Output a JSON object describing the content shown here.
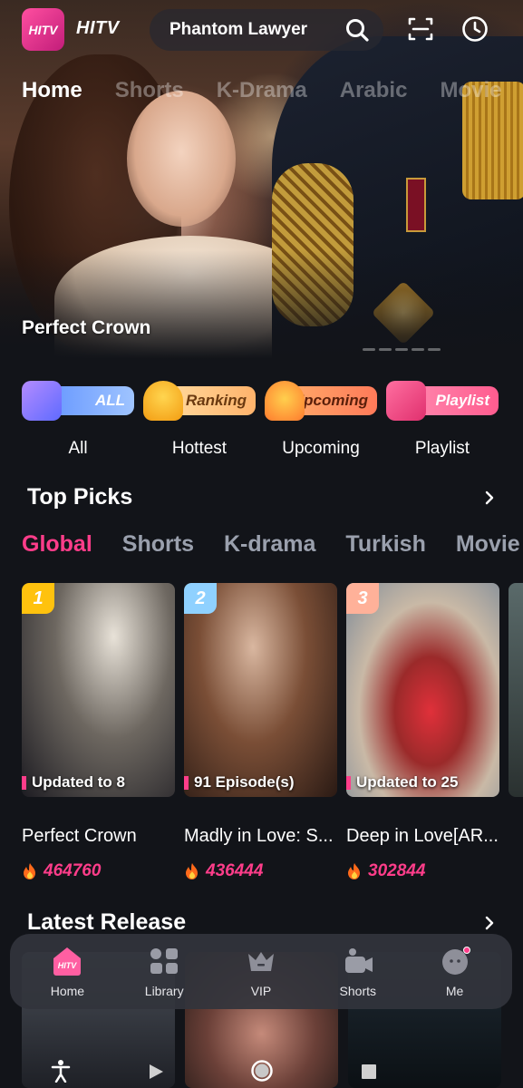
{
  "app": {
    "logo_text": "HITV",
    "logo_badge": "HITV"
  },
  "search": {
    "query": "Phantom Lawyer"
  },
  "top_tabs": [
    {
      "label": "Home",
      "active": true
    },
    {
      "label": "Shorts",
      "active": false
    },
    {
      "label": "K-Drama",
      "active": false
    },
    {
      "label": "Arabic",
      "active": false
    },
    {
      "label": "Movie",
      "active": false
    }
  ],
  "hero": {
    "title": "Perfect Crown"
  },
  "categories": [
    {
      "pill": "ALL",
      "label": "All",
      "color": "#6ba4ff"
    },
    {
      "pill": "Ranking",
      "label": "Hottest",
      "color": "#ffcc80"
    },
    {
      "pill": "Upcoming",
      "label": "Upcoming",
      "color": "#ff9d5c"
    },
    {
      "pill": "Playlist",
      "label": "Playlist",
      "color": "#ff7aa8"
    }
  ],
  "top_picks": {
    "title": "Top Picks",
    "subtabs": [
      {
        "label": "Global",
        "active": true
      },
      {
        "label": "Shorts",
        "active": false
      },
      {
        "label": "K-drama",
        "active": false
      },
      {
        "label": "Turkish",
        "active": false
      },
      {
        "label": "Movie",
        "active": false
      }
    ],
    "cards": [
      {
        "rank": "1",
        "status": "Updated to 8",
        "title": "Perfect Crown",
        "views": "464760",
        "rank_color": "#ffc20e"
      },
      {
        "rank": "2",
        "status": "91 Episode(s)",
        "title": "Madly in Love: S...",
        "views": "436444",
        "rank_color": "#8fd1ff"
      },
      {
        "rank": "3",
        "status": "Updated to 25",
        "title": "Deep in Love[AR...",
        "views": "302844",
        "rank_color": "#ffb199"
      }
    ]
  },
  "latest_release": {
    "title": "Latest Release"
  },
  "bottom_nav": [
    {
      "label": "Home",
      "active": true
    },
    {
      "label": "Library",
      "active": false
    },
    {
      "label": "VIP",
      "active": false
    },
    {
      "label": "Shorts",
      "active": false
    },
    {
      "label": "Me",
      "active": false
    }
  ],
  "colors": {
    "accent": "#ff3d8a",
    "background": "#121419"
  }
}
